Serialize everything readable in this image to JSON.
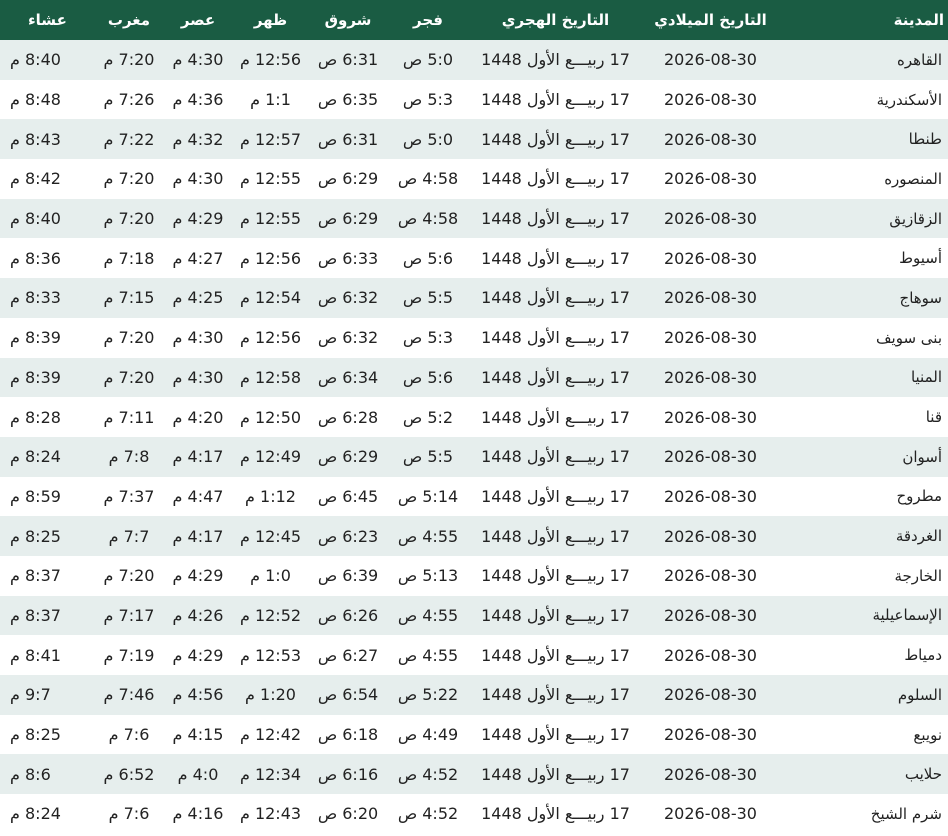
{
  "colors": {
    "header_bg": "#1a5c43",
    "header_text": "#ffffff",
    "row_alt_bg": "#e6eeed",
    "row_bg": "#ffffff"
  },
  "table": {
    "headers": {
      "city": "المدينة",
      "gregorian_date": "التاريخ الميلادي",
      "hijri_date": "التاريخ الهجري",
      "fajr": "فجر",
      "sunrise": "شروق",
      "dhuhr": "ظهر",
      "asr": "عصر",
      "maghrib": "مغرب",
      "isha": "عشاء"
    },
    "rows": [
      {
        "city": "القاهره",
        "gregorian_date": "2026-08-30",
        "hijri_date": "17 ربيـــع الأول 1448",
        "fajr": "5:0 ص",
        "sunrise": "6:31 ص",
        "dhuhr": "12:56 م",
        "asr": "4:30 م",
        "maghrib": "7:20 م",
        "isha": "8:40 م"
      },
      {
        "city": "الأسكندرية",
        "gregorian_date": "2026-08-30",
        "hijri_date": "17 ربيـــع الأول 1448",
        "fajr": "5:3 ص",
        "sunrise": "6:35 ص",
        "dhuhr": "1:1 م",
        "asr": "4:36 م",
        "maghrib": "7:26 م",
        "isha": "8:48 م"
      },
      {
        "city": "طنطا",
        "gregorian_date": "2026-08-30",
        "hijri_date": "17 ربيـــع الأول 1448",
        "fajr": "5:0 ص",
        "sunrise": "6:31 ص",
        "dhuhr": "12:57 م",
        "asr": "4:32 م",
        "maghrib": "7:22 م",
        "isha": "8:43 م"
      },
      {
        "city": "المنصوره",
        "gregorian_date": "2026-08-30",
        "hijri_date": "17 ربيـــع الأول 1448",
        "fajr": "4:58 ص",
        "sunrise": "6:29 ص",
        "dhuhr": "12:55 م",
        "asr": "4:30 م",
        "maghrib": "7:20 م",
        "isha": "8:42 م"
      },
      {
        "city": "الزقازيق",
        "gregorian_date": "2026-08-30",
        "hijri_date": "17 ربيـــع الأول 1448",
        "fajr": "4:58 ص",
        "sunrise": "6:29 ص",
        "dhuhr": "12:55 م",
        "asr": "4:29 م",
        "maghrib": "7:20 م",
        "isha": "8:40 م"
      },
      {
        "city": "أسيوط",
        "gregorian_date": "2026-08-30",
        "hijri_date": "17 ربيـــع الأول 1448",
        "fajr": "5:6 ص",
        "sunrise": "6:33 ص",
        "dhuhr": "12:56 م",
        "asr": "4:27 م",
        "maghrib": "7:18 م",
        "isha": "8:36 م"
      },
      {
        "city": "سوهاج",
        "gregorian_date": "2026-08-30",
        "hijri_date": "17 ربيـــع الأول 1448",
        "fajr": "5:5 ص",
        "sunrise": "6:32 ص",
        "dhuhr": "12:54 م",
        "asr": "4:25 م",
        "maghrib": "7:15 م",
        "isha": "8:33 م"
      },
      {
        "city": "بنى سويف",
        "gregorian_date": "2026-08-30",
        "hijri_date": "17 ربيـــع الأول 1448",
        "fajr": "5:3 ص",
        "sunrise": "6:32 ص",
        "dhuhr": "12:56 م",
        "asr": "4:30 م",
        "maghrib": "7:20 م",
        "isha": "8:39 م"
      },
      {
        "city": "المنيا",
        "gregorian_date": "2026-08-30",
        "hijri_date": "17 ربيـــع الأول 1448",
        "fajr": "5:6 ص",
        "sunrise": "6:34 ص",
        "dhuhr": "12:58 م",
        "asr": "4:30 م",
        "maghrib": "7:20 م",
        "isha": "8:39 م"
      },
      {
        "city": "قنا",
        "gregorian_date": "2026-08-30",
        "hijri_date": "17 ربيـــع الأول 1448",
        "fajr": "5:2 ص",
        "sunrise": "6:28 ص",
        "dhuhr": "12:50 م",
        "asr": "4:20 م",
        "maghrib": "7:11 م",
        "isha": "8:28 م"
      },
      {
        "city": "أسوان",
        "gregorian_date": "2026-08-30",
        "hijri_date": "17 ربيـــع الأول 1448",
        "fajr": "5:5 ص",
        "sunrise": "6:29 ص",
        "dhuhr": "12:49 م",
        "asr": "4:17 م",
        "maghrib": "7:8 م",
        "isha": "8:24 م"
      },
      {
        "city": "مطروح",
        "gregorian_date": "2026-08-30",
        "hijri_date": "17 ربيـــع الأول 1448",
        "fajr": "5:14 ص",
        "sunrise": "6:45 ص",
        "dhuhr": "1:12 م",
        "asr": "4:47 م",
        "maghrib": "7:37 م",
        "isha": "8:59 م"
      },
      {
        "city": "الغردقة",
        "gregorian_date": "2026-08-30",
        "hijri_date": "17 ربيـــع الأول 1448",
        "fajr": "4:55 ص",
        "sunrise": "6:23 ص",
        "dhuhr": "12:45 م",
        "asr": "4:17 م",
        "maghrib": "7:7 م",
        "isha": "8:25 م"
      },
      {
        "city": "الخارجة",
        "gregorian_date": "2026-08-30",
        "hijri_date": "17 ربيـــع الأول 1448",
        "fajr": "5:13 ص",
        "sunrise": "6:39 ص",
        "dhuhr": "1:0 م",
        "asr": "4:29 م",
        "maghrib": "7:20 م",
        "isha": "8:37 م"
      },
      {
        "city": "الإسماعيلية",
        "gregorian_date": "2026-08-30",
        "hijri_date": "17 ربيـــع الأول 1448",
        "fajr": "4:55 ص",
        "sunrise": "6:26 ص",
        "dhuhr": "12:52 م",
        "asr": "4:26 م",
        "maghrib": "7:17 م",
        "isha": "8:37 م"
      },
      {
        "city": "دمياط",
        "gregorian_date": "2026-08-30",
        "hijri_date": "17 ربيـــع الأول 1448",
        "fajr": "4:55 ص",
        "sunrise": "6:27 ص",
        "dhuhr": "12:53 م",
        "asr": "4:29 م",
        "maghrib": "7:19 م",
        "isha": "8:41 م"
      },
      {
        "city": "السلوم",
        "gregorian_date": "2026-08-30",
        "hijri_date": "17 ربيـــع الأول 1448",
        "fajr": "5:22 ص",
        "sunrise": "6:54 ص",
        "dhuhr": "1:20 م",
        "asr": "4:56 م",
        "maghrib": "7:46 م",
        "isha": "9:7 م"
      },
      {
        "city": "نويبع",
        "gregorian_date": "2026-08-30",
        "hijri_date": "17 ربيـــع الأول 1448",
        "fajr": "4:49 ص",
        "sunrise": "6:18 ص",
        "dhuhr": "12:42 م",
        "asr": "4:15 م",
        "maghrib": "7:6 م",
        "isha": "8:25 م"
      },
      {
        "city": "حلايب",
        "gregorian_date": "2026-08-30",
        "hijri_date": "17 ربيـــع الأول 1448",
        "fajr": "4:52 ص",
        "sunrise": "6:16 ص",
        "dhuhr": "12:34 م",
        "asr": "4:0 م",
        "maghrib": "6:52 م",
        "isha": "8:6 م"
      },
      {
        "city": "شرم الشيخ",
        "gregorian_date": "2026-08-30",
        "hijri_date": "17 ربيـــع الأول 1448",
        "fajr": "4:52 ص",
        "sunrise": "6:20 ص",
        "dhuhr": "12:43 م",
        "asr": "4:16 م",
        "maghrib": "7:6 م",
        "isha": "8:24 م"
      }
    ]
  }
}
